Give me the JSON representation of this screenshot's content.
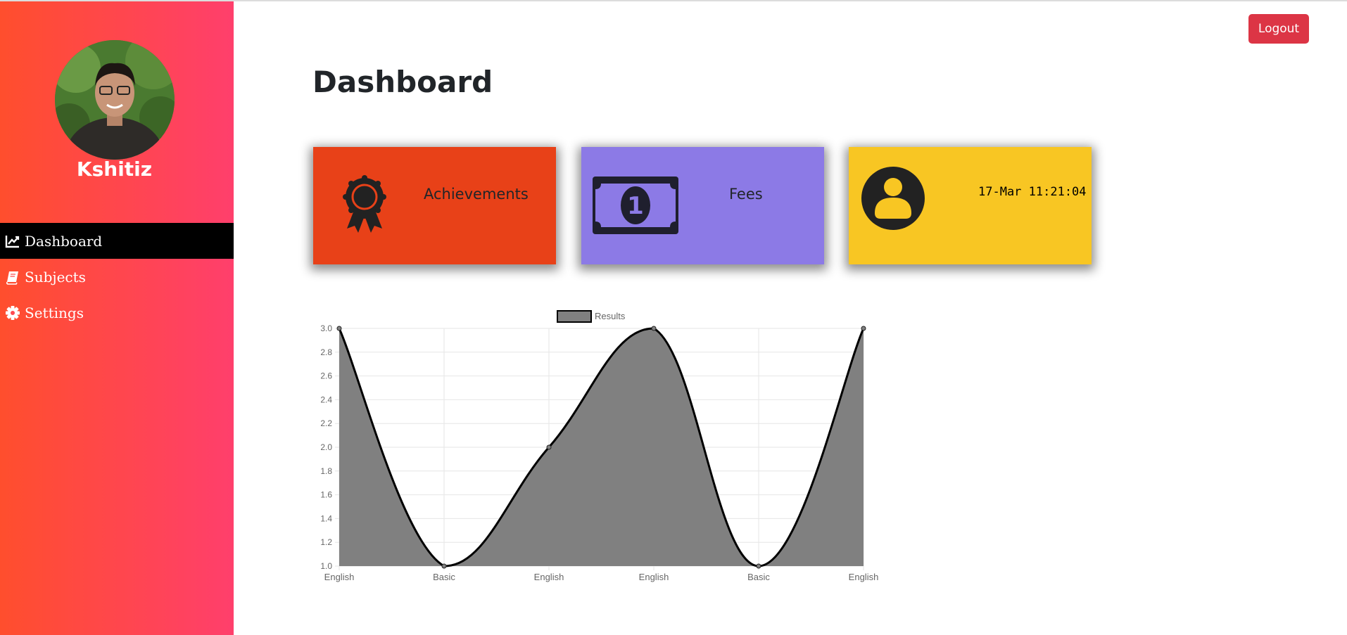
{
  "sidebar": {
    "user_name": "Kshitiz",
    "avatar_icon": "user-photo",
    "items": [
      {
        "label": "Dashboard",
        "icon": "line-chart-icon",
        "active": true
      },
      {
        "label": "Subjects",
        "icon": "book-icon",
        "active": false
      },
      {
        "label": "Settings",
        "icon": "gear-icon",
        "active": false
      }
    ],
    "gradient": [
      "#ff4e2d",
      "#ff3f6c"
    ]
  },
  "header": {
    "logout_label": "Logout",
    "logout_color": "#dc3545"
  },
  "main": {
    "title": "Dashboard",
    "cards": [
      {
        "label": "Achievements",
        "icon": "award-ribbon-icon",
        "color": "#e84118"
      },
      {
        "label": "Fees",
        "icon": "money-bill-icon",
        "color": "#8c7ae6"
      },
      {
        "label": "17-Mar 11:21:04",
        "icon": "user-circle-icon",
        "color": "#f8c623"
      }
    ]
  },
  "chart_data": {
    "type": "area",
    "categories": [
      "English",
      "Basic",
      "English",
      "English",
      "Basic",
      "English"
    ],
    "series": [
      {
        "name": "Results",
        "values": [
          3.0,
          1.0,
          2.0,
          3.0,
          1.0,
          3.0
        ]
      }
    ],
    "ylim": [
      1.0,
      3.0
    ],
    "yticks": [
      "3.0",
      "2.8",
      "2.6",
      "2.4",
      "2.2",
      "2.0",
      "1.8",
      "1.6",
      "1.4",
      "1.2",
      "1.0"
    ],
    "legend": "top-center",
    "grid": true,
    "fill_color": "#808080",
    "line_color": "#000000"
  }
}
